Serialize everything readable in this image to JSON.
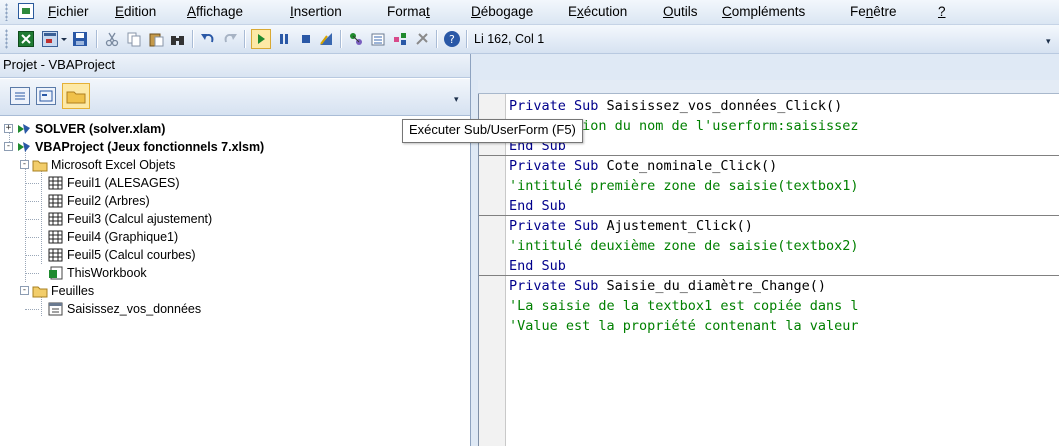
{
  "menubar": {
    "items": [
      {
        "pre": "",
        "u": "F",
        "post": "ichier"
      },
      {
        "pre": "",
        "u": "E",
        "post": "dition"
      },
      {
        "pre": "",
        "u": "A",
        "post": "ffichage"
      },
      {
        "pre": "",
        "u": "I",
        "post": "nsertion"
      },
      {
        "pre": "Forma",
        "u": "t",
        "post": ""
      },
      {
        "pre": "",
        "u": "D",
        "post": "ébogage"
      },
      {
        "pre": "E",
        "u": "x",
        "post": "écution"
      },
      {
        "pre": "",
        "u": "O",
        "post": "utils"
      },
      {
        "pre": "",
        "u": "C",
        "post": "ompléments"
      },
      {
        "pre": "Fe",
        "u": "n",
        "post": "être"
      },
      {
        "pre": "",
        "u": "?",
        "post": ""
      }
    ]
  },
  "toolbar": {
    "cursor_position": "Li 162, Col 1",
    "icons": [
      "excel-view-icon",
      "insert-userform-icon",
      "dropdown-arrow-icon",
      "save-icon",
      "cut-icon",
      "copy-icon",
      "paste-icon",
      "find-icon",
      "undo-icon",
      "redo-icon",
      "run-icon",
      "break-icon",
      "reset-icon",
      "design-mode-icon",
      "project-explorer-icon",
      "properties-icon",
      "object-browser-icon",
      "toolbox-icon",
      "help-icon"
    ]
  },
  "project": {
    "title": "Projet - VBAProject",
    "tools": [
      "view-code-icon",
      "view-object-icon",
      "toggle-folders-icon"
    ],
    "tree": [
      {
        "label": "SOLVER (solver.xlam)",
        "bold": true,
        "exp": "+",
        "icon": "vba-project-icon"
      },
      {
        "label": "VBAProject (Jeux fonctionnels 7.xlsm)",
        "bold": true,
        "exp": "-",
        "icon": "vba-project-icon"
      },
      {
        "label": "Microsoft Excel Objets",
        "bold": false,
        "exp": "-",
        "icon": "folder-icon"
      },
      {
        "label": "Feuil1 (ALESAGES)",
        "bold": false,
        "exp": "",
        "icon": "worksheet-icon"
      },
      {
        "label": "Feuil2 (Arbres)",
        "bold": false,
        "exp": "",
        "icon": "worksheet-icon"
      },
      {
        "label": "Feuil3 (Calcul ajustement)",
        "bold": false,
        "exp": "",
        "icon": "worksheet-icon"
      },
      {
        "label": "Feuil4 (Graphique1)",
        "bold": false,
        "exp": "",
        "icon": "worksheet-icon"
      },
      {
        "label": "Feuil5 (Calcul courbes)",
        "bold": false,
        "exp": "",
        "icon": "worksheet-icon"
      },
      {
        "label": "ThisWorkbook",
        "bold": false,
        "exp": "",
        "icon": "workbook-icon"
      },
      {
        "label": "Feuilles",
        "bold": false,
        "exp": "-",
        "icon": "folder-icon"
      },
      {
        "label": "Saisissez_vos_données",
        "bold": false,
        "exp": "",
        "icon": "userform-icon"
      }
    ]
  },
  "tooltip": "Exécuter Sub/UserForm (F5)",
  "code": {
    "lines": [
      {
        "kw": "Private Sub ",
        "rest": "Saisissez_vos_données_Click()",
        "type": "sub"
      },
      {
        "kw": "",
        "rest": "'Déclaration du nom de l'userform:saisissez",
        "type": "comment"
      },
      {
        "kw": "End Sub",
        "rest": "",
        "type": "end"
      },
      {
        "kw": "Private Sub ",
        "rest": "Cote_nominale_Click()",
        "type": "sub"
      },
      {
        "kw": "",
        "rest": "'intitulé première zone de saisie(textbox1)",
        "type": "comment"
      },
      {
        "kw": "End Sub",
        "rest": "",
        "type": "end"
      },
      {
        "kw": "Private Sub ",
        "rest": "Ajustement_Click()",
        "type": "sub"
      },
      {
        "kw": "",
        "rest": "'intitulé deuxième zone de saisie(textbox2)",
        "type": "comment"
      },
      {
        "kw": "End Sub",
        "rest": "",
        "type": "end"
      },
      {
        "kw": "Private Sub ",
        "rest": "Saisie_du_diamètre_Change()",
        "type": "sub"
      },
      {
        "kw": "",
        "rest": "'La saisie de la textbox1 est copiée dans l",
        "type": "comment"
      },
      {
        "kw": "",
        "rest": "'Value est la propriété contenant la valeur",
        "type": "comment"
      }
    ]
  },
  "colors": {
    "keyword": "#00008b",
    "comment": "#008000",
    "accent": "#dfe9f5"
  }
}
